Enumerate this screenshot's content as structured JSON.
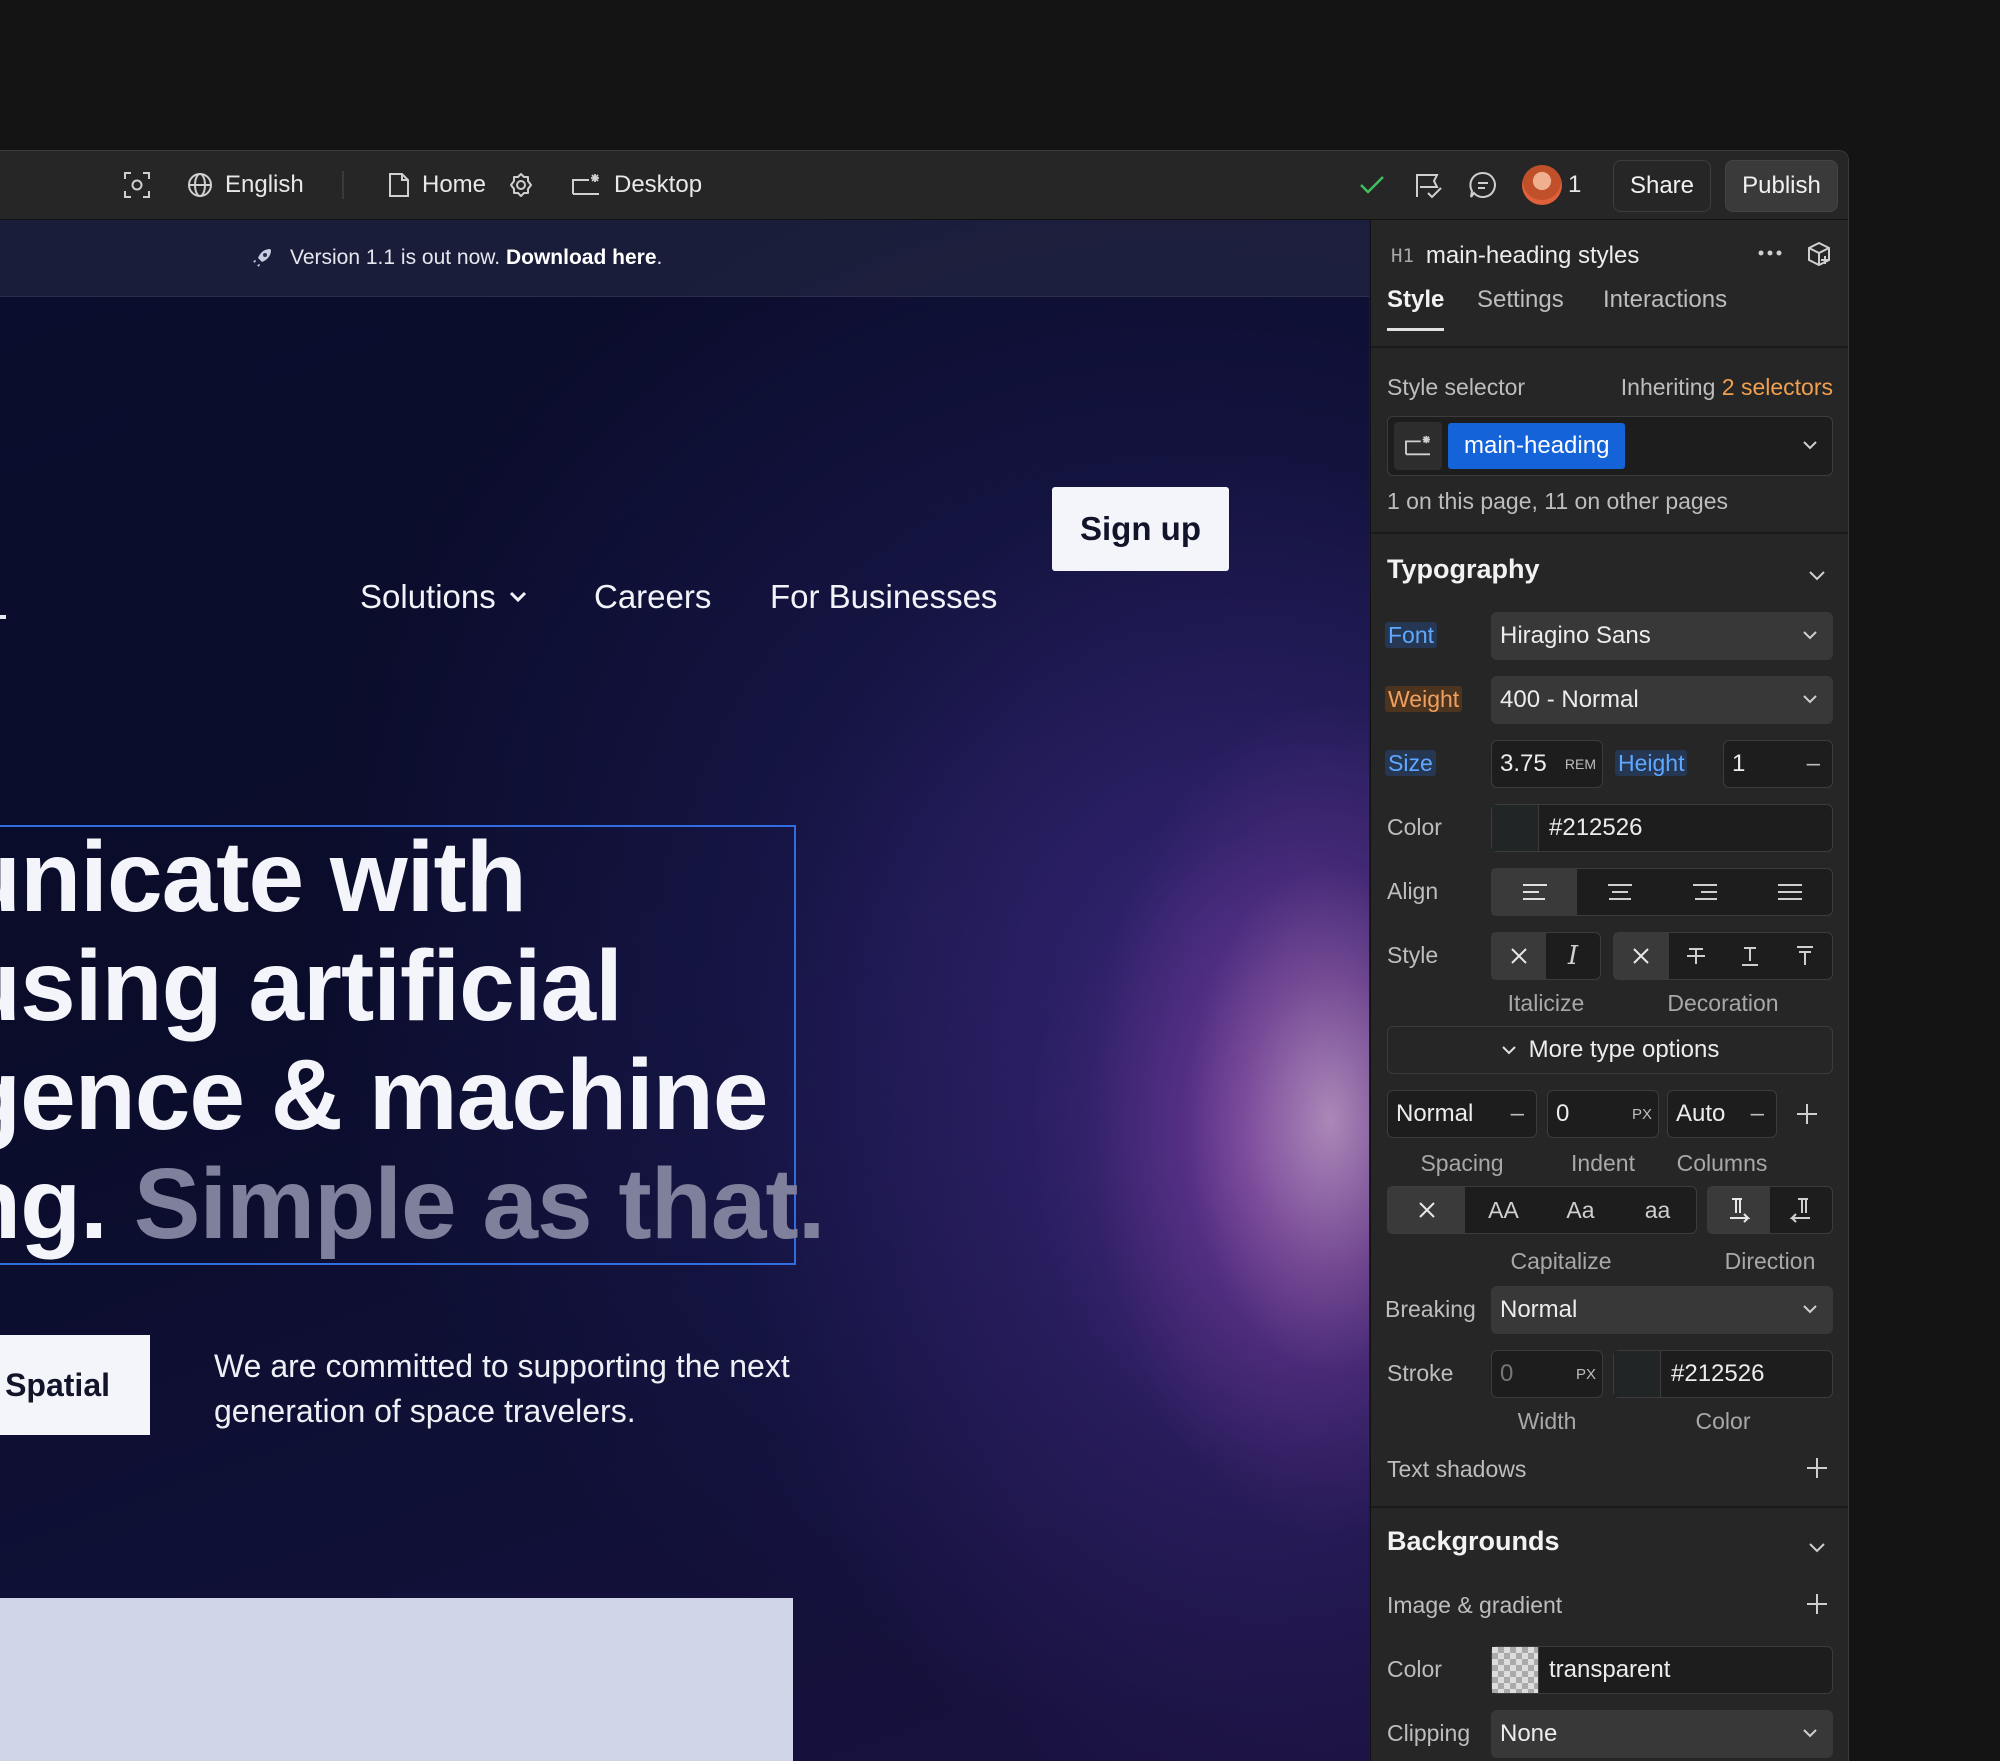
{
  "toolbar": {
    "language": "English",
    "page": "Home",
    "breakpoint": "Desktop",
    "collaborator_count": "1",
    "share_label": "Share",
    "publish_label": "Publish"
  },
  "site": {
    "banner": {
      "text": "Version 1.1 is out now.",
      "link": "Download here",
      "suffix": "."
    },
    "nav": {
      "solutions": "Solutions",
      "careers": "Careers",
      "businesses": "For Businesses",
      "signup": "Sign up"
    },
    "heading": {
      "line1": "unicate with",
      "line2": "using artificial",
      "line3": "gence & machine",
      "line4_a": "ng.",
      "line4_b": "Simple as that."
    },
    "cta": "Spatial",
    "description": "We are committed to supporting the next generation of space travelers."
  },
  "panel": {
    "element_tag": "H1",
    "element_title": "main-heading styles",
    "tabs": [
      "Style",
      "Settings",
      "Interactions"
    ],
    "style_selector_label": "Style selector",
    "inheriting_prefix": "Inheriting",
    "inheriting_count": "2 selectors",
    "selector_chip": "main-heading",
    "selector_usage": "1 on this page, 11 on other pages",
    "typography": {
      "title": "Typography",
      "font_label": "Font",
      "font_value": "Hiragino Sans",
      "weight_label": "Weight",
      "weight_value": "400 - Normal",
      "size_label": "Size",
      "size_value": "3.75",
      "size_unit": "REM",
      "height_label": "Height",
      "height_value": "1",
      "color_label": "Color",
      "color_value": "#212526",
      "align_label": "Align",
      "style_label": "Style",
      "italicize_label": "Italicize",
      "decoration_label": "Decoration",
      "more_options": "More type options",
      "spacing_value": "Normal",
      "indent_value": "0",
      "indent_unit": "PX",
      "columns_value": "Auto",
      "spacing_label": "Spacing",
      "indent_label": "Indent",
      "columns_label": "Columns",
      "cap_options": [
        "AA",
        "Aa",
        "aa"
      ],
      "capitalize_label": "Capitalize",
      "direction_label": "Direction",
      "breaking_label": "Breaking",
      "breaking_value": "Normal",
      "stroke_label": "Stroke",
      "stroke_width": "0",
      "stroke_unit": "PX",
      "stroke_color": "#212526",
      "width_label": "Width",
      "stroke_color_label": "Color",
      "text_shadows_label": "Text shadows"
    },
    "backgrounds": {
      "title": "Backgrounds",
      "image_gradient_label": "Image & gradient",
      "color_label": "Color",
      "color_value": "transparent",
      "clipping_label": "Clipping",
      "clipping_value": "None"
    }
  },
  "colors": {
    "accent_blue": "#1463d8",
    "selection_outline": "#2f6de0",
    "success_check": "#3fbf5f",
    "inherit_orange": "#f0a050"
  }
}
